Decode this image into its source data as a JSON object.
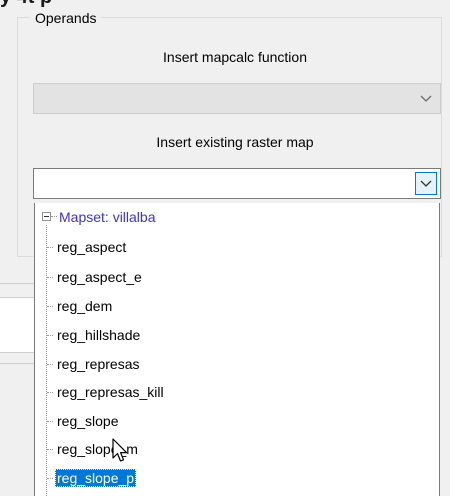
{
  "header_fragment": "y 4t                    p",
  "operands": {
    "group_title": "Operands",
    "mapcalc_label": "Insert mapcalc function",
    "mapcalc_value": "",
    "raster_label": "Insert existing raster map",
    "raster_value": ""
  },
  "dropdown": {
    "root_label": "Mapset: villalba",
    "items": [
      {
        "label": "reg_aspect",
        "selected": false
      },
      {
        "label": "reg_aspect_e",
        "selected": false
      },
      {
        "label": "reg_dem",
        "selected": false
      },
      {
        "label": "reg_hillshade",
        "selected": false
      },
      {
        "label": "reg_represas",
        "selected": false
      },
      {
        "label": "reg_represas_kill",
        "selected": false
      },
      {
        "label": "reg_slope",
        "selected": false
      },
      {
        "label": "reg_slope_m",
        "selected": false
      },
      {
        "label": "reg_slope_p",
        "selected": true
      }
    ]
  },
  "icons": {
    "expander": "minus-box-icon",
    "combo_arrow": "chevron-down-icon",
    "cursor": "mouse-pointer-icon"
  },
  "colors": {
    "selection": "#0078d7",
    "mapset_text": "#3d33d6",
    "focus_border": "#0078d7"
  }
}
